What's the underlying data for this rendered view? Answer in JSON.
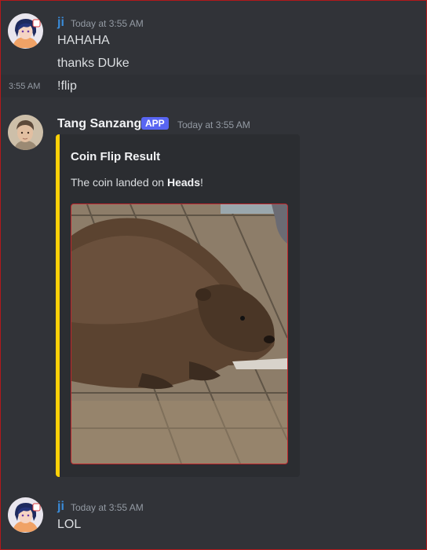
{
  "messages": [
    {
      "username": "ji",
      "username_color": "#3a8bd8",
      "timestamp": "Today at 3:55 AM",
      "lines": [
        "HAHAHA",
        "thanks DUke"
      ]
    }
  ],
  "hover_message": {
    "side_time": "3:55 AM",
    "text": "!flip"
  },
  "bot_message": {
    "username": "Tang Sanzang",
    "badge": "APP",
    "timestamp": "Today at 3:55 AM",
    "embed": {
      "accent_color": "#fed107",
      "title": "Coin Flip Result",
      "desc_prefix": "The coin landed on ",
      "desc_bold": "Heads",
      "desc_suffix": "!",
      "image_subject": "beaver on wooden deck"
    }
  },
  "last_message": {
    "username": "ji",
    "timestamp": "Today at 3:55 AM",
    "text": "LOL"
  }
}
